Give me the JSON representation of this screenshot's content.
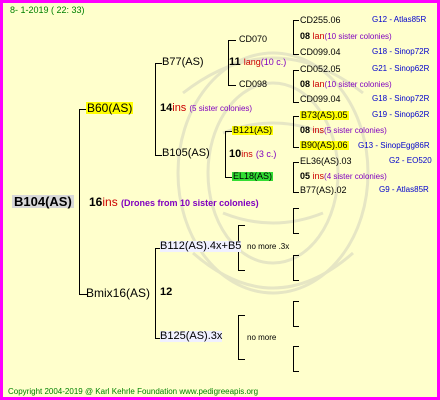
{
  "header": {
    "date": "8-  1-2019 ( 22: 33)"
  },
  "footer": {
    "copyright": "Copyright 2004-2019 @ Karl Kehrle Foundation   www.pedigreeapis.org"
  },
  "root": {
    "name": "B104(AS)",
    "gen_num": "16",
    "ins": "ins",
    "drones": "(Drones from 10 sister colonies)"
  },
  "sire": {
    "name": "B60(AS)",
    "gen_num": "14",
    "ins": "ins",
    "sisters": "(5 sister colonies)"
  },
  "sire_sire": {
    "name": "B77(AS)",
    "gen_num": "11",
    "lang": "lang",
    "count": "(10 c.)"
  },
  "sire_dam": {
    "name": "B105(AS)",
    "gen_num": "10",
    "ins": "ins",
    "count": "(3 c.)"
  },
  "cd070": {
    "name": "CD070",
    "rows": [
      {
        "name": "CD255.06",
        "code": "G12 - Atlas85R"
      },
      {
        "num": "08",
        "word": "lan",
        "note": "(10 sister colonies)"
      },
      {
        "name": "CD099.04",
        "code": "G18 - Sinop72R"
      }
    ]
  },
  "cd098": {
    "name": "CD098",
    "rows": [
      {
        "name": "CD052.05",
        "code": "G21 - Sinop62R"
      },
      {
        "num": "08",
        "word": "lan",
        "note": "(10 sister colonies)"
      },
      {
        "name": "CD099.04",
        "code": "G18 - Sinop72R"
      }
    ]
  },
  "b121": {
    "name": "B121(AS)",
    "rows": [
      {
        "name": "B73(AS).05",
        "code": "G19 - Sinop62R"
      },
      {
        "num": "08",
        "word": "ins",
        "note": "(5 sister colonies)"
      },
      {
        "name": "B90(AS).06",
        "code": "G13 - SinopEgg86R"
      }
    ]
  },
  "el18": {
    "name": "EL18(AS)",
    "rows": [
      {
        "name": "EL36(AS).03",
        "code": "G2 - EO520"
      },
      {
        "num": "05",
        "word": "ins",
        "note": "(4 sister colonies)"
      },
      {
        "name": "B77(AS).02",
        "code": "G9 - Atlas85R"
      }
    ]
  },
  "dam": {
    "name": "Bmix16(AS)",
    "gen_num": "12"
  },
  "dam_sire": {
    "name": "B112(AS).4x+B5",
    "note": "no more .3x"
  },
  "dam_dam": {
    "name": "B125(AS).3x",
    "note": "no more"
  }
}
